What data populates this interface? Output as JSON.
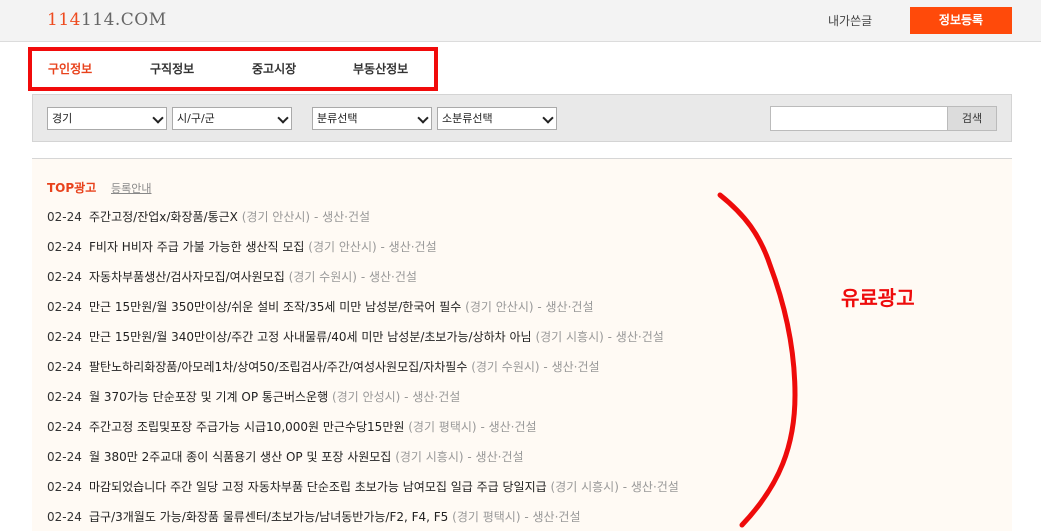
{
  "header": {
    "logo_hl": "114",
    "logo_rest": "114.COM",
    "my_posts": "내가쓴글",
    "register": "정보등록"
  },
  "tabs": [
    {
      "label": "구인정보",
      "active": true
    },
    {
      "label": "구직정보",
      "active": false
    },
    {
      "label": "중고시장",
      "active": false
    },
    {
      "label": "부동산정보",
      "active": false
    }
  ],
  "filters": {
    "region": "경기",
    "city": "시/구/군",
    "category": "분류선택",
    "subcategory": "소분류선택",
    "search_value": "",
    "search_button": "검색"
  },
  "top_ads": {
    "title": "TOP광고",
    "guide_link": "등록안내",
    "rows": [
      {
        "date": "02-24",
        "title": "주간고정/잔업x/화장품/통근X",
        "location": "(경기 안산시)",
        "category": "- 생산·건설"
      },
      {
        "date": "02-24",
        "title": "F비자 H비자 주급 가불 가능한 생산직 모집",
        "location": "(경기 안산시)",
        "category": "- 생산·건설"
      },
      {
        "date": "02-24",
        "title": "자동차부품생산/검사자모집/여사원모집",
        "location": "(경기 수원시)",
        "category": "- 생산·건설"
      },
      {
        "date": "02-24",
        "title": "만근 15만원/월 350만이상/쉬운 설비 조작/35세 미만 남성분/한국어 필수",
        "location": "(경기 안산시)",
        "category": "- 생산·건설"
      },
      {
        "date": "02-24",
        "title": "만근 15만원/월 340만이상/주간 고정 사내물류/40세 미만 남성분/초보가능/상하차 아님",
        "location": "(경기 시흥시)",
        "category": "- 생산·건설"
      },
      {
        "date": "02-24",
        "title": "팔탄노하리화장품/아모레1차/상여50/조립검사/주간/여성사원모집/자차필수",
        "location": "(경기 수원시)",
        "category": "- 생산·건설"
      },
      {
        "date": "02-24",
        "title": "월 370가능 단순포장 및 기계 OP 통근버스운행",
        "location": "(경기 안성시)",
        "category": "- 생산·건설"
      },
      {
        "date": "02-24",
        "title": "주간고정 조립및포장 주급가능 시급10,000원 만근수당15만원",
        "location": "(경기 평택시)",
        "category": "- 생산·건설"
      },
      {
        "date": "02-24",
        "title": "월 380만 2주교대 종이 식품용기 생산 OP 및 포장 사원모집",
        "location": "(경기 시흥시)",
        "category": "- 생산·건설"
      },
      {
        "date": "02-24",
        "title": "마감되었습니다 주간 일당 고정 자동차부품 단순조립 초보가능 남여모집 일급 주급 당일지급",
        "location": "(경기 시흥시)",
        "category": "- 생산·건설"
      },
      {
        "date": "02-24",
        "title": "급구/3개월도 가능/화장품 물류센터/초보가능/남녀동반가능/F2, F4, F5",
        "location": "(경기 평택시)",
        "category": "- 생산·건설"
      }
    ]
  },
  "annotation": {
    "label": "유료광고",
    "color": "#ee0b0b"
  },
  "colors": {
    "accent": "#e8421c",
    "button": "#ff4a0a",
    "highlight_box": "#f10b0b"
  }
}
